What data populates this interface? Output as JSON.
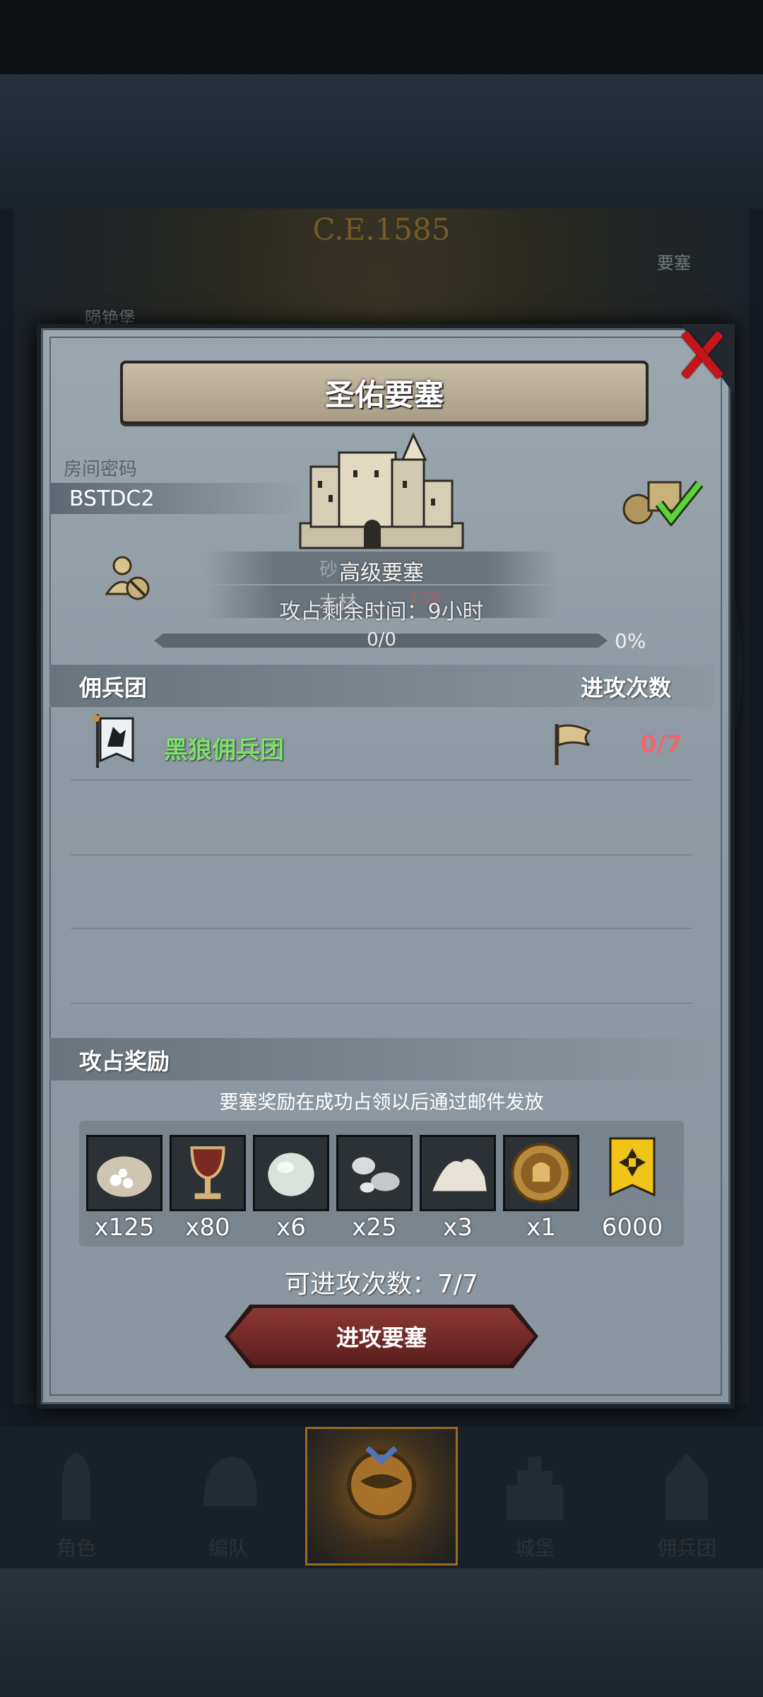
{
  "background": {
    "year": "C.E.1585",
    "labels": [
      "陨铯堡",
      "要塞"
    ]
  },
  "dialog": {
    "title": "圣佑要塞",
    "room_label": "房间密码",
    "room_code": "BSTDC2",
    "ghost_text_1": "砂",
    "fortress_level": "高级要塞",
    "ghost_text_2": "木材",
    "ghost_text_2b": "128",
    "occupy_time": "攻占剩余时间：9小时",
    "progress_text": "0/0",
    "progress_pct": "0%",
    "progress_value": 0,
    "mercenary_header": "佣兵团",
    "attack_count_header": "进攻次数",
    "mercenaries": [
      {
        "name": "黑狼佣兵团",
        "count": "0/7"
      }
    ],
    "reward_header": "攻占奖励",
    "reward_note": "要塞奖励在成功占领以后通过邮件发放",
    "rewards": [
      {
        "icon": "flour-sack-icon",
        "qty": "x125"
      },
      {
        "icon": "goblet-icon",
        "qty": "x80"
      },
      {
        "icon": "gem-stone-icon",
        "qty": "x6"
      },
      {
        "icon": "silver-ore-icon",
        "qty": "x25"
      },
      {
        "icon": "salt-pile-icon",
        "qty": "x3"
      },
      {
        "icon": "knight-medal-icon",
        "qty": "x1"
      },
      {
        "icon": "gold-badge-icon",
        "qty": "6000"
      }
    ],
    "attempts": "可进攻次数：7/7",
    "attack_button": "进攻要塞"
  },
  "nav": {
    "items": [
      {
        "label": "角色",
        "icon": "knight-icon"
      },
      {
        "label": "编队",
        "icon": "helmet-icon"
      },
      {
        "label": "前往群岛",
        "icon": "compass-icon"
      },
      {
        "label": "城堡",
        "icon": "castle-icon"
      },
      {
        "label": "佣兵团",
        "icon": "mercenary-icon"
      }
    ]
  },
  "colors": {
    "accent_green": "#7ee06a",
    "count_red": "#e9686c",
    "button_red": "#8d3833",
    "close_red": "#c2161b"
  }
}
